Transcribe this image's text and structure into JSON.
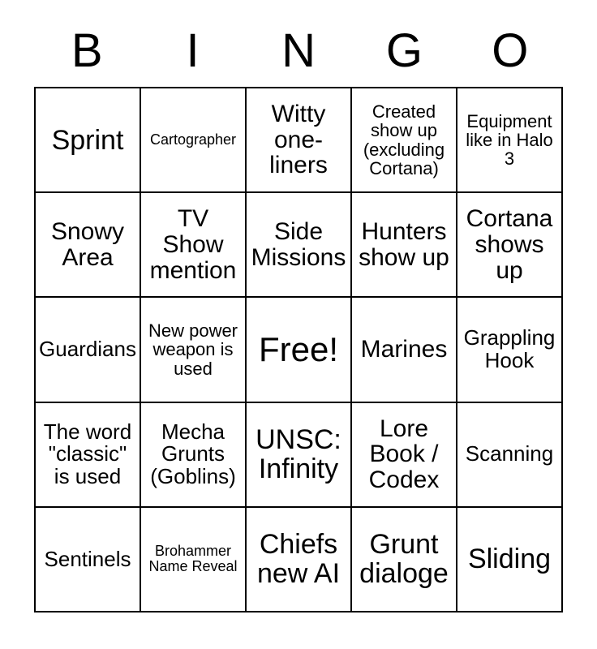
{
  "card": {
    "title_letters": [
      "B",
      "I",
      "N",
      "G",
      "O"
    ],
    "columns": 5,
    "rows": 5,
    "border_color": "#000000",
    "background_color": "#ffffff",
    "text_color": "#000000",
    "free_space": {
      "row": 3,
      "column": 3,
      "label": "Free!"
    }
  },
  "squares": [
    {
      "text": "Sprint",
      "size": "xl"
    },
    {
      "text": "Cartographer",
      "size": "xs"
    },
    {
      "text": "Witty one-liners",
      "size": "l"
    },
    {
      "text": "Created show up (excluding Cortana)",
      "size": "s"
    },
    {
      "text": "Equipment like in Halo 3",
      "size": "s"
    },
    {
      "text": "Snowy Area",
      "size": "l"
    },
    {
      "text": "TV Show mention",
      "size": "l"
    },
    {
      "text": "Side Missions",
      "size": "l"
    },
    {
      "text": "Hunters show up",
      "size": "l"
    },
    {
      "text": "Cortana shows up",
      "size": "l"
    },
    {
      "text": "Guardians",
      "size": "m"
    },
    {
      "text": "New power weapon is used",
      "size": "s"
    },
    {
      "text": "Free!",
      "size": "xxl"
    },
    {
      "text": "Marines",
      "size": "l"
    },
    {
      "text": "Grappling Hook",
      "size": "m"
    },
    {
      "text": "The word \"classic\" is used",
      "size": "m"
    },
    {
      "text": "Mecha Grunts (Goblins)",
      "size": "m"
    },
    {
      "text": "UNSC: Infinity",
      "size": "xl"
    },
    {
      "text": "Lore Book / Codex",
      "size": "l"
    },
    {
      "text": "Scanning",
      "size": "m"
    },
    {
      "text": "Sentinels",
      "size": "m"
    },
    {
      "text": "Brohammer Name Reveal",
      "size": "xs"
    },
    {
      "text": "Chiefs new AI",
      "size": "xl"
    },
    {
      "text": "Grunt dialoge",
      "size": "xl"
    },
    {
      "text": "Sliding",
      "size": "xl"
    }
  ]
}
